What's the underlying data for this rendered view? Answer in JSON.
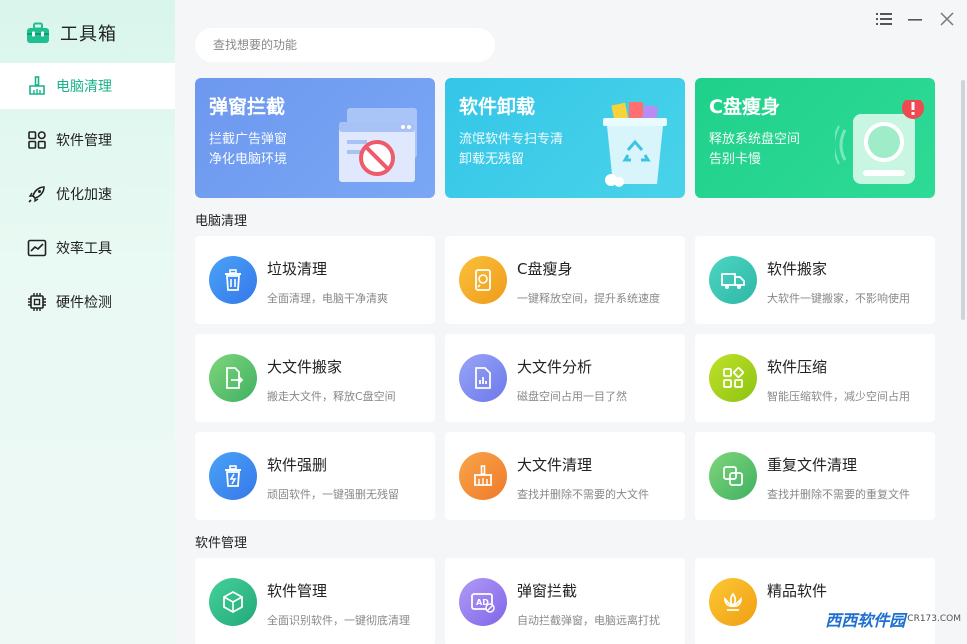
{
  "app": {
    "title": "工具箱"
  },
  "sidebar": {
    "items": [
      {
        "label": "电脑清理",
        "icon": "broom-icon",
        "active": true
      },
      {
        "label": "软件管理",
        "icon": "apps-grid-icon",
        "active": false
      },
      {
        "label": "优化加速",
        "icon": "rocket-icon",
        "active": false
      },
      {
        "label": "效率工具",
        "icon": "chart-trend-icon",
        "active": false
      },
      {
        "label": "硬件检测",
        "icon": "chip-icon",
        "active": false
      }
    ]
  },
  "search": {
    "placeholder": "查找想要的功能",
    "value": ""
  },
  "window_controls": [
    "menu-icon",
    "minimize-icon",
    "close-icon"
  ],
  "banners": [
    {
      "title": "弹窗拦截",
      "line1": "拦截广告弹窗",
      "line2": "净化电脑环境",
      "color": "#6d98ef"
    },
    {
      "title": "软件卸载",
      "line1": "流氓软件专扫专清",
      "line2": "卸载无残留",
      "color": "#34c6e8"
    },
    {
      "title": "C盘瘦身",
      "line1": "释放系统盘空间",
      "line2": "告别卡慢",
      "color": "#1fd08b"
    }
  ],
  "sections": [
    {
      "title": "电脑清理",
      "cards": [
        {
          "title": "垃圾清理",
          "desc": "全面清理，电脑干净清爽",
          "icon": "trash-icon",
          "color": "#3e8ef0"
        },
        {
          "title": "C盘瘦身",
          "desc": "一键释放空间，提升系统速度",
          "icon": "disk-icon",
          "color": "#f5a623"
        },
        {
          "title": "软件搬家",
          "desc": "大软件一键搬家，不影响使用",
          "icon": "truck-icon",
          "color": "#38c7b5"
        },
        {
          "title": "大文件搬家",
          "desc": "搬走大文件，释放C盘空间",
          "icon": "file-export-icon",
          "color": "#5fc46e"
        },
        {
          "title": "大文件分析",
          "desc": "磁盘空间占用一目了然",
          "icon": "file-chart-icon",
          "color": "#7f8cf0"
        },
        {
          "title": "软件压缩",
          "desc": "智能压缩软件，减少空间占用",
          "icon": "compress-grid-icon",
          "color": "#9ccf18"
        },
        {
          "title": "软件强删",
          "desc": "顽固软件，一键强删无残留",
          "icon": "force-delete-icon",
          "color": "#3e8ef0"
        },
        {
          "title": "大文件清理",
          "desc": "查找并删除不需要的大文件",
          "icon": "broom-icon",
          "color": "#f5893a"
        },
        {
          "title": "重复文件清理",
          "desc": "查找并删除不需要的重复文件",
          "icon": "duplicate-icon",
          "color": "#5fc46e"
        }
      ]
    },
    {
      "title": "软件管理",
      "cards": [
        {
          "title": "软件管理",
          "desc": "全面识别软件，一键彻底清理",
          "icon": "cube-icon",
          "color": "#32bb86"
        },
        {
          "title": "弹窗拦截",
          "desc": "自动拦截弹窗，电脑远离打扰",
          "icon": "ad-block-icon",
          "color": "#8f7ef0"
        },
        {
          "title": "精品软件",
          "desc": "",
          "icon": "lotus-icon",
          "color": "#f5b21a"
        }
      ]
    }
  ],
  "watermark": {
    "text": "西西软件园",
    "sub": "CR173.COM"
  }
}
